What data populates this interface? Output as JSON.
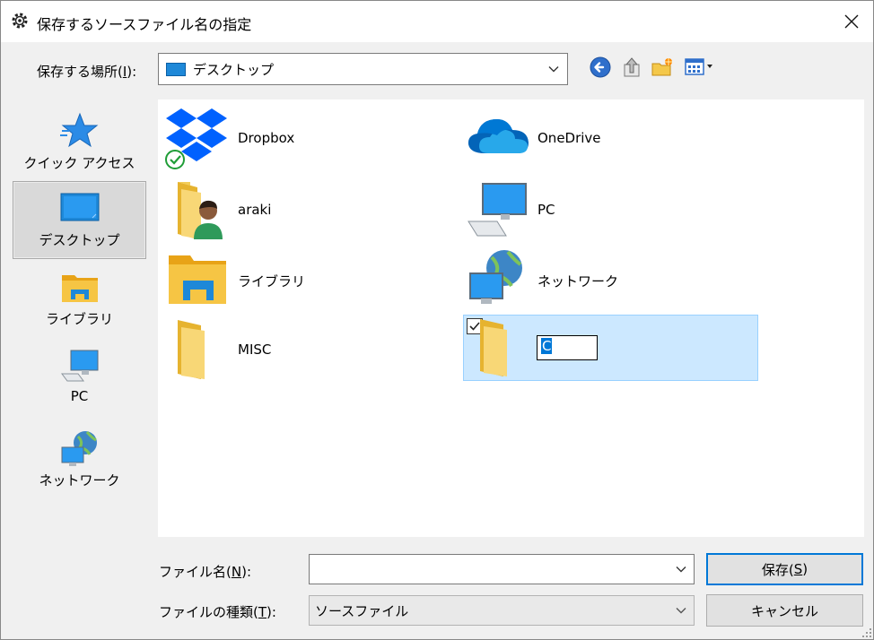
{
  "window": {
    "title": "保存するソースファイル名の指定"
  },
  "toolbar": {
    "location_label_prefix": "保存する場所(",
    "location_label_key": "I",
    "location_label_suffix": "):",
    "location_value": "デスクトップ",
    "icons": [
      "back-icon",
      "up-folder-icon",
      "new-folder-icon",
      "view-menu-icon"
    ]
  },
  "places": [
    {
      "label": "クイック アクセス",
      "icon": "star-icon"
    },
    {
      "label": "デスクトップ",
      "icon": "desktop-icon",
      "selected": true
    },
    {
      "label": "ライブラリ",
      "icon": "library-icon"
    },
    {
      "label": "PC",
      "icon": "pc-icon"
    },
    {
      "label": "ネットワーク",
      "icon": "network-icon"
    }
  ],
  "items": [
    {
      "label": "Dropbox",
      "icon": "dropbox-icon"
    },
    {
      "label": "OneDrive",
      "icon": "onedrive-icon"
    },
    {
      "label": "araki",
      "icon": "user-folder-icon"
    },
    {
      "label": "PC",
      "icon": "pc-icon"
    },
    {
      "label": "ライブラリ",
      "icon": "library-icon"
    },
    {
      "label": "ネットワーク",
      "icon": "network-icon"
    },
    {
      "label": "MISC",
      "icon": "folder-icon"
    }
  ],
  "renaming": {
    "value": "C",
    "checked": true
  },
  "filename": {
    "label_prefix": "ファイル名(",
    "label_key": "N",
    "label_suffix": "):",
    "value": ""
  },
  "filetype": {
    "label_prefix": "ファイルの種類(",
    "label_key": "T",
    "label_suffix": "):",
    "value": "ソースファイル"
  },
  "buttons": {
    "save_prefix": "保存(",
    "save_key": "S",
    "save_suffix": ")",
    "cancel": "キャンセル"
  },
  "colors": {
    "selection_bg": "#cce8ff",
    "selection_border": "#99d1ff",
    "accent": "#0078d7"
  }
}
